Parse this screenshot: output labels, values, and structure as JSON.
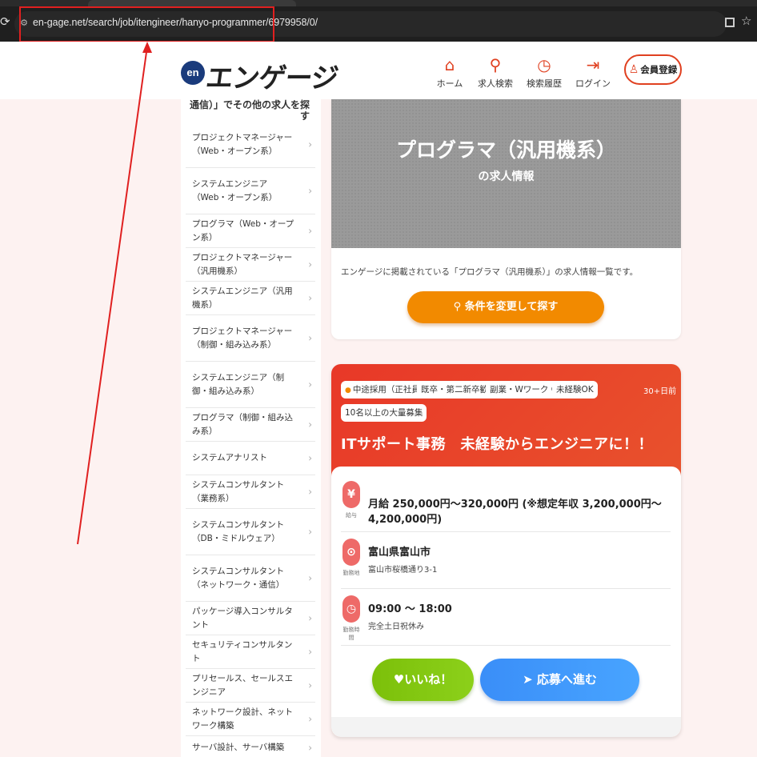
{
  "browser": {
    "url": "en-gage.net/search/job/itengineer/hanyo-programmer/6979958/0/",
    "reload_icon": "reload-icon",
    "site_info_icon": "site-info-icon",
    "qr_icon": "qr-code-icon",
    "bookmark_icon": "star-icon"
  },
  "header": {
    "logo_mark": "en",
    "logo_text": "エンゲージ",
    "nav": [
      {
        "label": "ホーム",
        "icon": "home-icon"
      },
      {
        "label": "求人検索",
        "icon": "search-icon"
      },
      {
        "label": "検索履歴",
        "icon": "history-icon"
      },
      {
        "label": "ログイン",
        "icon": "login-icon"
      }
    ],
    "register_label": "会員登録",
    "accent": "#e04020"
  },
  "sidebar": {
    "heading": "通信）」でその他の求人を探す",
    "items": [
      {
        "label": "プロジェクトマネージャー（Web・オープン系）"
      },
      {
        "label": "システムエンジニア（Web・オープン系）"
      },
      {
        "label": "プログラマ（Web・オープン系）"
      },
      {
        "label": "プロジェクトマネージャー（汎用機系）"
      },
      {
        "label": "システムエンジニア（汎用機系）"
      },
      {
        "label": "プロジェクトマネージャー（制御・組み込み系）"
      },
      {
        "label": "システムエンジニア（制御・組み込み系）"
      },
      {
        "label": "プログラマ（制御・組み込み系）"
      },
      {
        "label": "システムアナリスト"
      },
      {
        "label": "システムコンサルタント（業務系）"
      },
      {
        "label": "システムコンサルタント（DB・ミドルウェア）"
      },
      {
        "label": "システムコンサルタント（ネットワーク・通信）"
      },
      {
        "label": "パッケージ導入コンサルタント"
      },
      {
        "label": "セキュリティコンサルタント"
      },
      {
        "label": "プリセールス、セールスエンジニア"
      },
      {
        "label": "ネットワーク設計、ネットワーク構築"
      },
      {
        "label": "サーバ設計、サーバ構築"
      }
    ]
  },
  "hero": {
    "title": "プログラマ（汎用機系）",
    "subtitle": "の求人情報",
    "description": "エンゲージに掲載されている「プログラマ（汎用機系）」の求人情報一覧です。",
    "search_button": "条件を変更して探す",
    "search_icon": "search-icon"
  },
  "job": {
    "tags": [
      "中途採用（正社員）",
      "既卒・第二新卒歓迎",
      "副業・Wワーク OK",
      "未経験OK",
      "10名以上の大量募集"
    ],
    "posted": "30+日前",
    "title": "ITサポート事務　未経験からエンジニアに！！",
    "salary": {
      "icon": "yen-icon",
      "caption": "給与",
      "main": "月給 250,000円～320,000円 (※想定年収 3,200,000円～4,200,000円)"
    },
    "location": {
      "icon": "map-pin-icon",
      "caption": "勤務地",
      "main": "富山県富山市",
      "sub": "富山市桜橋通り3-1"
    },
    "hours": {
      "icon": "clock-icon",
      "caption": "勤務時間",
      "main": "09:00 ～ 18:00",
      "sub": "完全土日祝休み"
    },
    "like_button": "いいね！",
    "apply_button": "応募へ進む"
  }
}
